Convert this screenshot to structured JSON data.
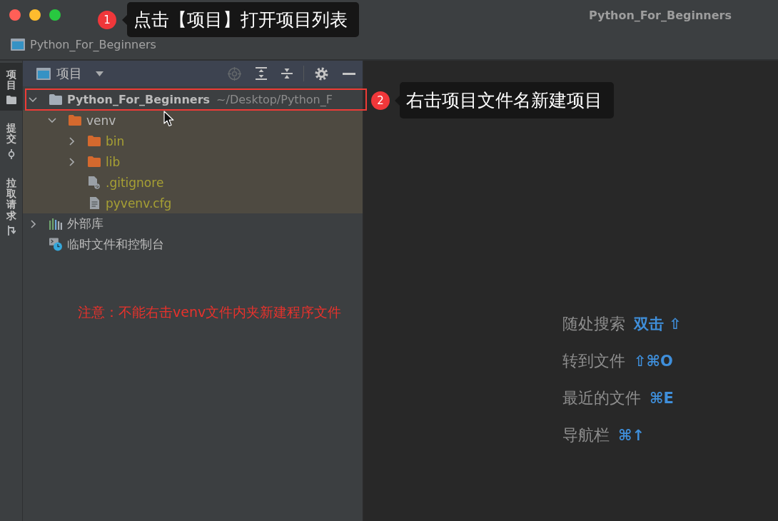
{
  "window": {
    "title": "Python_For_Beginners"
  },
  "navigation_bar": {
    "breadcrumb": "Python_For_Beginners"
  },
  "tool_strip": [
    {
      "label": "项目",
      "kind": "project",
      "selected": true
    },
    {
      "label": "提交",
      "kind": "commit",
      "selected": false
    },
    {
      "label": "拉取请求",
      "kind": "pull-request",
      "selected": false
    }
  ],
  "project_panel": {
    "view": "项目",
    "tree": [
      {
        "name": "Python_For_Beginners",
        "path": "~/Desktop/Python_F",
        "kind": "folder",
        "expanded": true,
        "excluded": false,
        "ignored": false,
        "children": [
          {
            "name": "venv",
            "kind": "folder",
            "expanded": true,
            "excluded": true,
            "ignored": false,
            "children": [
              {
                "name": "bin",
                "kind": "folder",
                "expanded": false,
                "excluded": true,
                "ignored": true
              },
              {
                "name": "lib",
                "kind": "folder",
                "expanded": false,
                "excluded": true,
                "ignored": true
              },
              {
                "name": ".gitignore",
                "kind": "ignore-file",
                "excluded": true,
                "ignored": true
              },
              {
                "name": "pyvenv.cfg",
                "kind": "text-file",
                "excluded": true,
                "ignored": true
              }
            ]
          }
        ]
      },
      {
        "name": "外部库",
        "kind": "library",
        "expanded": false,
        "excluded": false,
        "ignored": false
      },
      {
        "name": "临时文件和控制台",
        "kind": "scratch",
        "excluded": false,
        "ignored": false
      }
    ]
  },
  "note": "注意：不能右击venv文件内夹新建程序文件",
  "editor_hints": [
    {
      "label": "随处搜索",
      "shortcut": "双击 ⇧"
    },
    {
      "label": "转到文件",
      "shortcut": "⇧⌘O"
    },
    {
      "label": "最近的文件",
      "shortcut": "⌘E"
    },
    {
      "label": "导航栏",
      "shortcut": "⌘↑"
    }
  ],
  "callouts": [
    {
      "number": "1",
      "text": "点击【项目】打开项目列表"
    },
    {
      "number": "2",
      "text": "右击项目文件名新建项目"
    }
  ]
}
